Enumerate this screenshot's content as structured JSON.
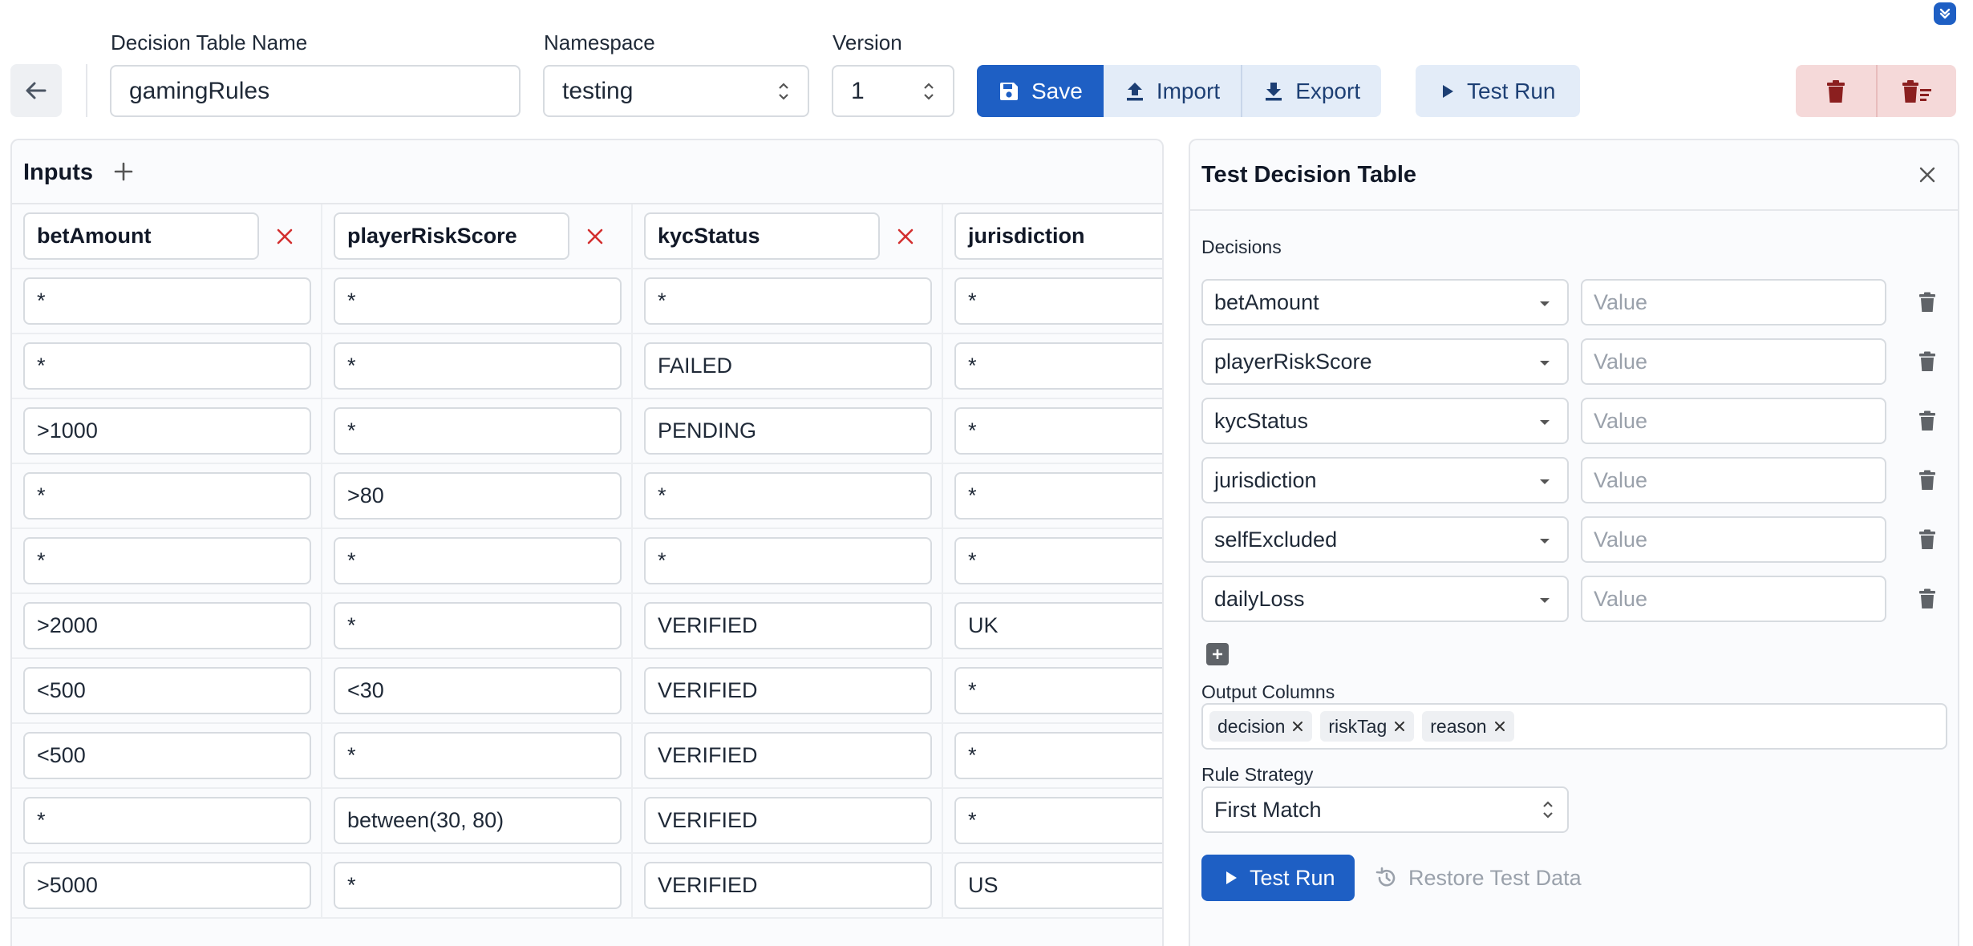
{
  "header": {
    "name_label": "Decision Table Name",
    "name_value": "gamingRules",
    "namespace_label": "Namespace",
    "namespace_value": "testing",
    "version_label": "Version",
    "version_value": "1",
    "actions": {
      "save": "Save",
      "import": "Import",
      "export": "Export",
      "test_run": "Test Run"
    }
  },
  "inputs_panel": {
    "title": "Inputs",
    "columns": [
      "betAmount",
      "playerRiskScore",
      "kycStatus",
      "jurisdiction"
    ],
    "rows": [
      [
        "*",
        "*",
        "*",
        "*"
      ],
      [
        "*",
        "*",
        "FAILED",
        "*"
      ],
      [
        ">1000",
        "*",
        "PENDING",
        "*"
      ],
      [
        "*",
        ">80",
        "*",
        "*"
      ],
      [
        "*",
        "*",
        "*",
        "*"
      ],
      [
        ">2000",
        "*",
        "VERIFIED",
        "UK"
      ],
      [
        "<500",
        "<30",
        "VERIFIED",
        "*"
      ],
      [
        "<500",
        "*",
        "VERIFIED",
        "*"
      ],
      [
        "*",
        "between(30, 80)",
        "VERIFIED",
        "*"
      ],
      [
        ">5000",
        "*",
        "VERIFIED",
        "US"
      ]
    ]
  },
  "test_panel": {
    "title": "Test Decision Table",
    "decisions_label": "Decisions",
    "decisions": [
      {
        "field": "betAmount",
        "placeholder": "Value"
      },
      {
        "field": "playerRiskScore",
        "placeholder": "Value"
      },
      {
        "field": "kycStatus",
        "placeholder": "Value"
      },
      {
        "field": "jurisdiction",
        "placeholder": "Value"
      },
      {
        "field": "selfExcluded",
        "placeholder": "Value"
      },
      {
        "field": "dailyLoss",
        "placeholder": "Value"
      }
    ],
    "output_columns_label": "Output Columns",
    "output_columns": [
      "decision",
      "riskTag",
      "reason"
    ],
    "rule_strategy_label": "Rule Strategy",
    "rule_strategy_value": "First Match",
    "test_run_label": "Test Run",
    "restore_label": "Restore Test Data"
  },
  "colors": {
    "primary": "#1e5fc4",
    "light_button": "#e3ecf8",
    "danger_bg": "#f5d9d9",
    "danger_icon": "#8b1f1f",
    "remove_x": "#d32f2f"
  }
}
